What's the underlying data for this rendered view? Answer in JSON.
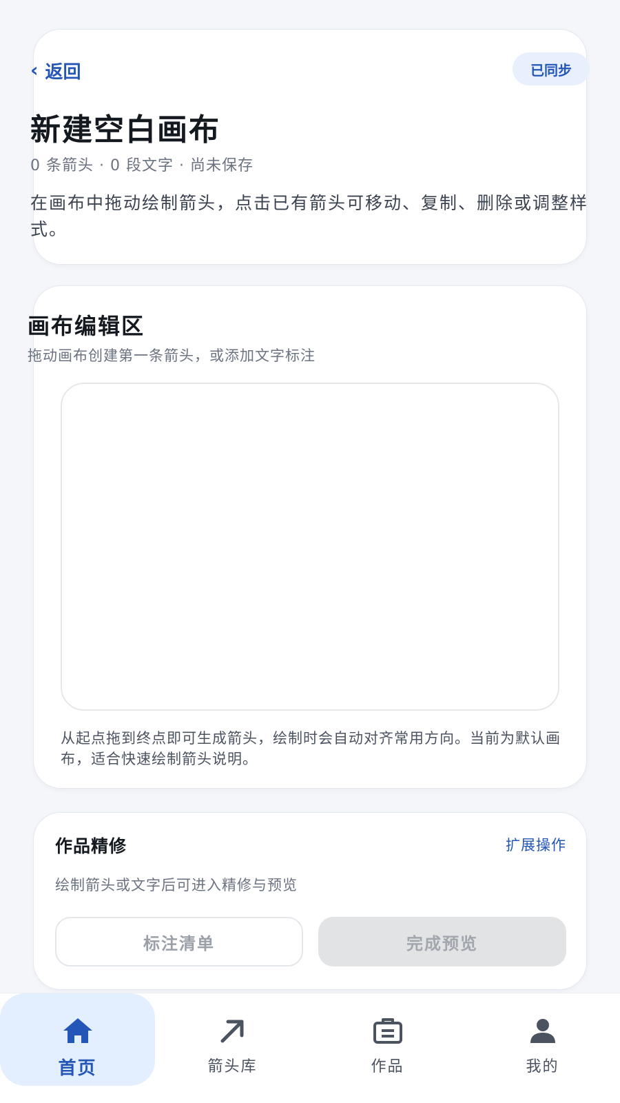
{
  "header": {
    "back_label": "返回",
    "sync_status": "已同步",
    "title": "新建空白画布",
    "meta": "0 条箭头 · 0 段文字 · 尚未保存",
    "intro": "在画布中拖动绘制箭头，点击已有箭头可移动、复制、删除或调整样式。"
  },
  "canvas": {
    "title": "画布编辑区",
    "subtitle": "拖动画布创建第一条箭头，或添加文字标注",
    "hint": "从起点拖到终点即可生成箭头，绘制时会自动对齐常用方向。当前为默认画布，适合快速绘制箭头说明。"
  },
  "refine": {
    "title": "作品精修",
    "extend_link": "扩展操作",
    "description": "绘制箭头或文字后可进入精修与预览",
    "annotation_list_button": "标注清单",
    "finish_preview_button": "完成预览"
  },
  "nav": {
    "items": [
      {
        "label": "首页",
        "icon": "home-icon",
        "active": true
      },
      {
        "label": "箭头库",
        "icon": "arrow-icon",
        "active": false
      },
      {
        "label": "作品",
        "icon": "briefcase-icon",
        "active": false
      },
      {
        "label": "我的",
        "icon": "user-icon",
        "active": false
      }
    ]
  },
  "colors": {
    "accent": "#2456b8",
    "background": "#f4f6fa",
    "active_nav_bg": "#e3eefe",
    "sync_badge_bg": "#e8f0fd",
    "disabled_button_bg": "#e2e3e5"
  }
}
